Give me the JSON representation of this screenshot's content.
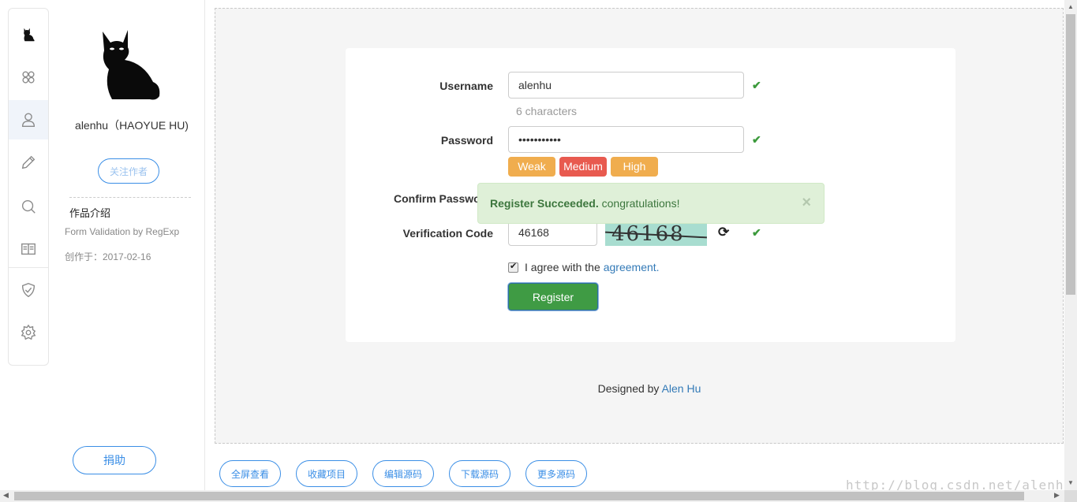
{
  "author": {
    "name": "alenhu（HAOYUE HU)",
    "follow_label": "关注作者",
    "intro_title": "作品介绍",
    "intro_desc": "Form Validation by RegExp",
    "created": "创作于：2017-02-16",
    "donate_label": "捐助"
  },
  "form": {
    "username": {
      "label": "Username",
      "value": "alenhu",
      "hint": "6 characters"
    },
    "password": {
      "label": "Password",
      "value": "•••••••••••"
    },
    "strength": {
      "weak": "Weak",
      "medium": "Medium",
      "high": "High",
      "colors": {
        "weak": "#f0ad4e",
        "medium": "#e85a4f",
        "high": "#f0ad4e"
      }
    },
    "confirm": {
      "label": "Confirm Passwo"
    },
    "verification": {
      "label": "Verification Code",
      "value": "46168",
      "captcha_text": "46168"
    },
    "agree": {
      "text": "I agree with the",
      "link": "agreement",
      "suffix": "."
    },
    "register_label": "Register"
  },
  "alert": {
    "bold": "Register Succeeded.",
    "text": " congratulations!",
    "close": "×"
  },
  "credit": {
    "prefix": "Designed by ",
    "link": "Alen Hu"
  },
  "actions": [
    "全屏查看",
    "收藏项目",
    "编辑源码",
    "下载源码",
    "更多源码"
  ],
  "watermark": "http://blog.csdn.net/alenhhy",
  "colors": {
    "accent": "#3a8ee6",
    "success": "#3c9a3c",
    "register": "#3f9b44"
  }
}
